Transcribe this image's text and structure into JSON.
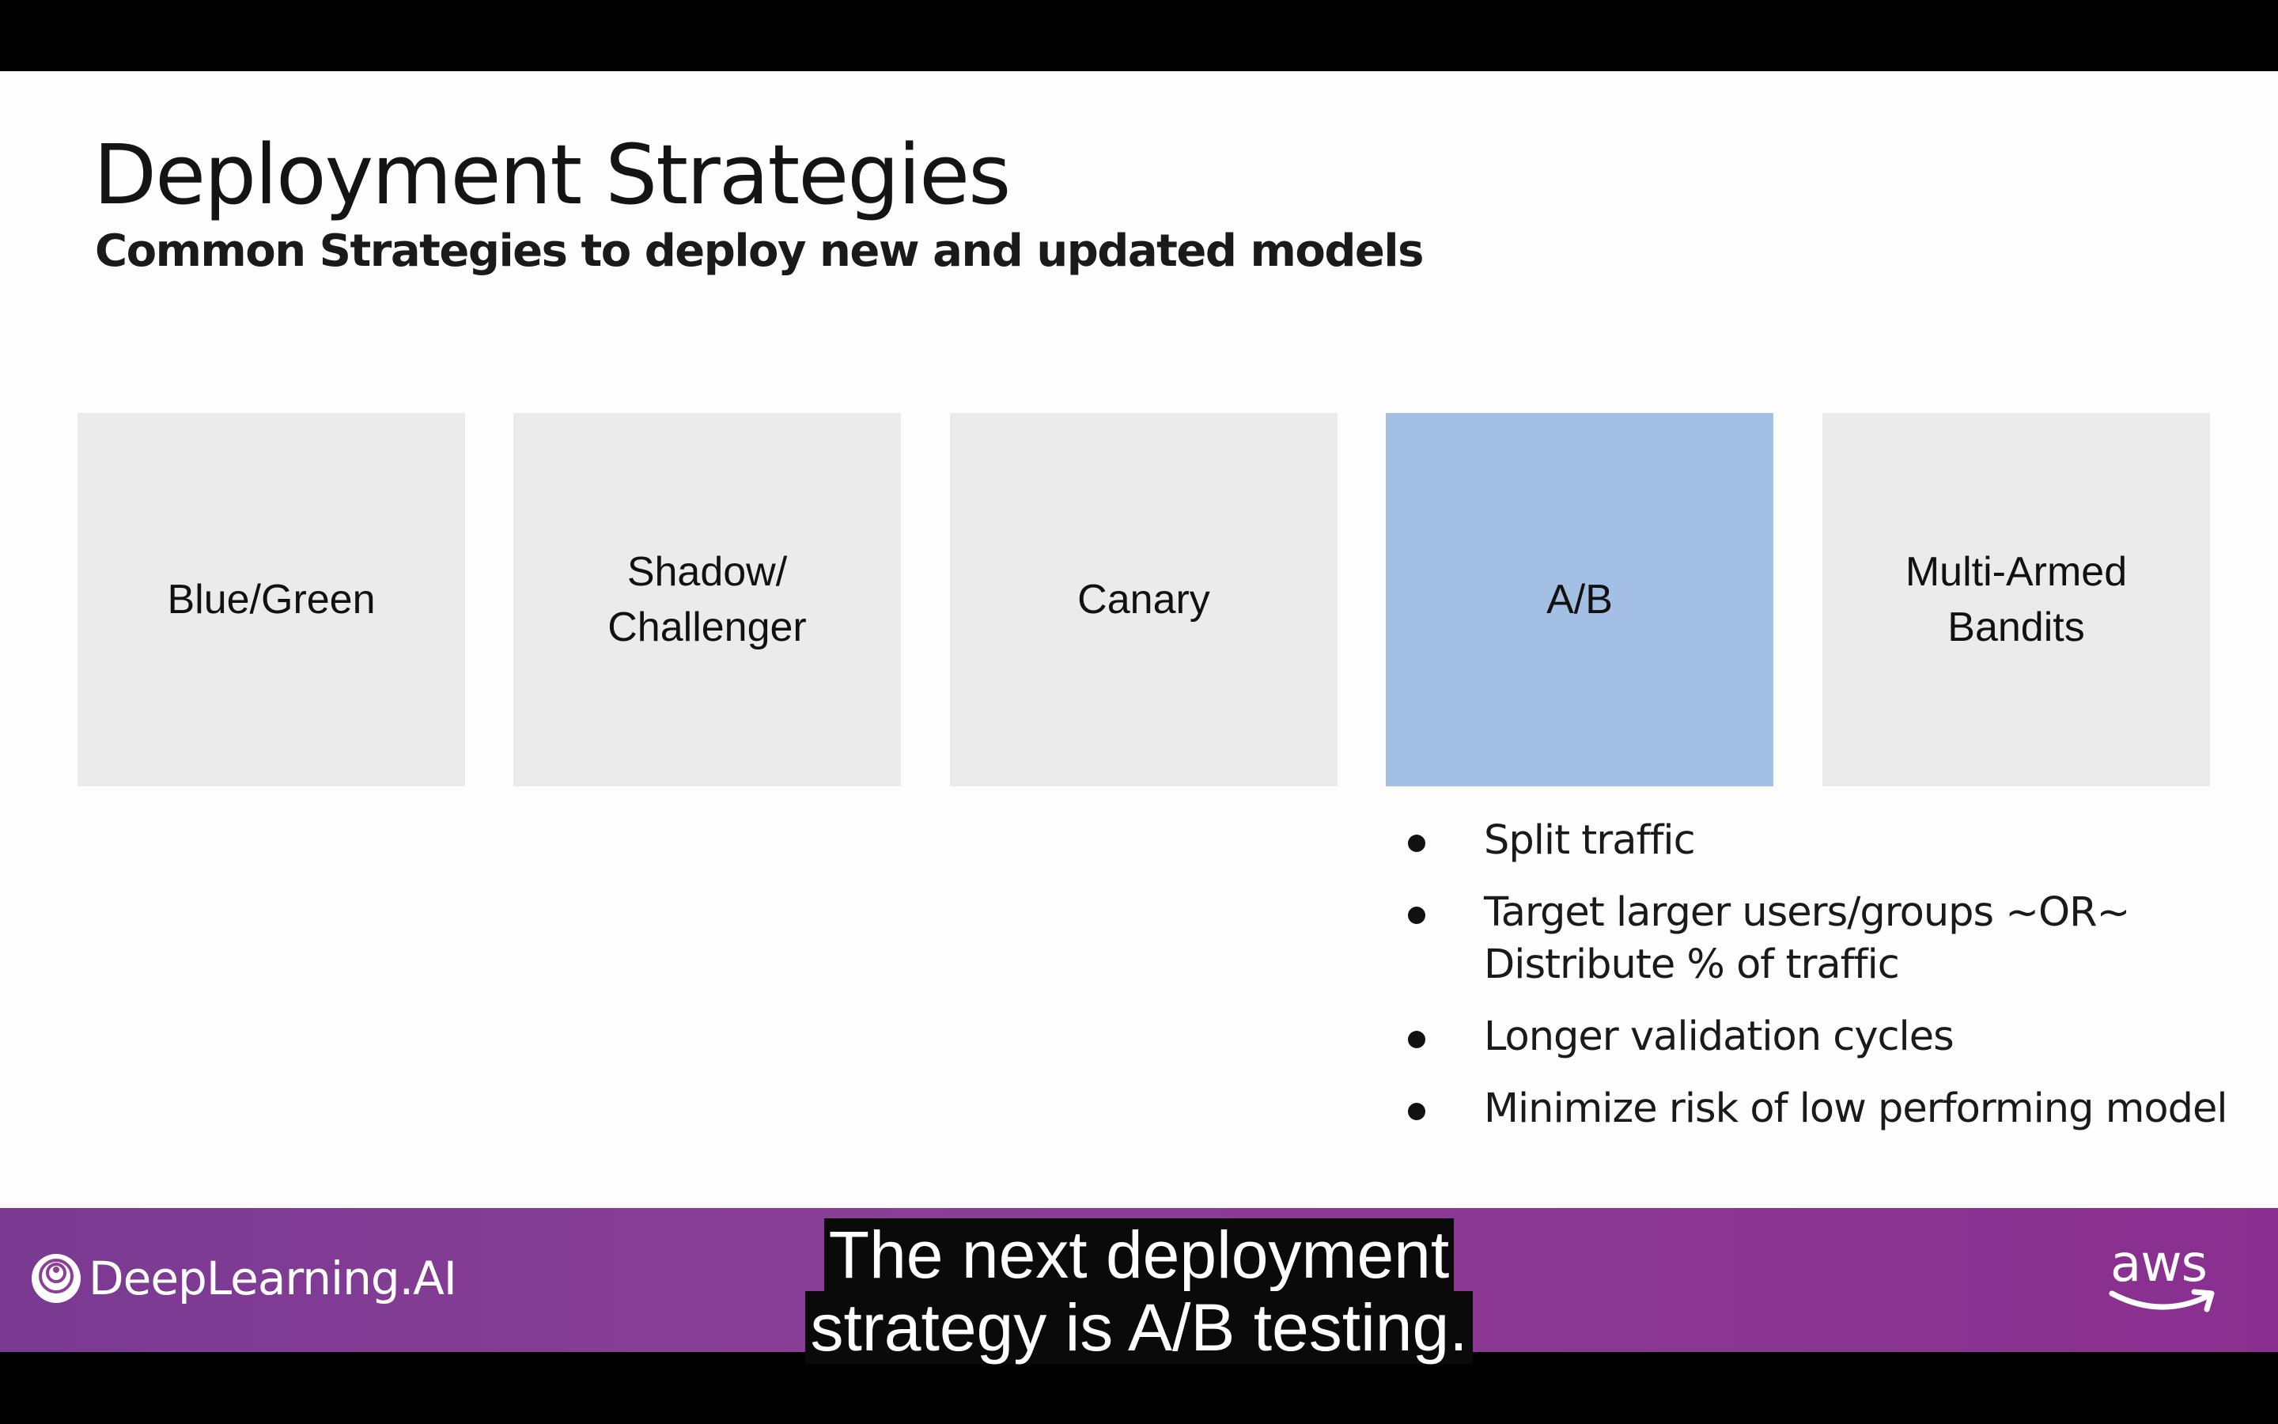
{
  "slide": {
    "title": "Deployment Strategies",
    "subtitle": "Common Strategies to deploy new and updated models",
    "strategies": [
      {
        "label": "Blue/Green",
        "active": false
      },
      {
        "label": "Shadow/\nChallenger",
        "active": false
      },
      {
        "label": "Canary",
        "active": false
      },
      {
        "label": "A/B",
        "active": true
      },
      {
        "label": "Multi-Armed\nBandits",
        "active": false
      }
    ],
    "bullets": [
      "Split traffic",
      "Target larger  users/groups ~OR~\nDistribute % of traffic",
      "Longer validation cycles",
      "Minimize risk of low performing model"
    ]
  },
  "footer": {
    "brand": "DeepLearning.AI",
    "brand_logo_icon": "deeplearning-ai-logo-icon",
    "partner": "aws",
    "partner_logo_icon": "aws-logo-icon"
  },
  "caption": {
    "line1": "The next deployment",
    "line2": "strategy is A/B testing."
  },
  "colors": {
    "box_default": "#ebebeb",
    "box_active": "#a3bfe3",
    "footer": "#8b3f97"
  }
}
